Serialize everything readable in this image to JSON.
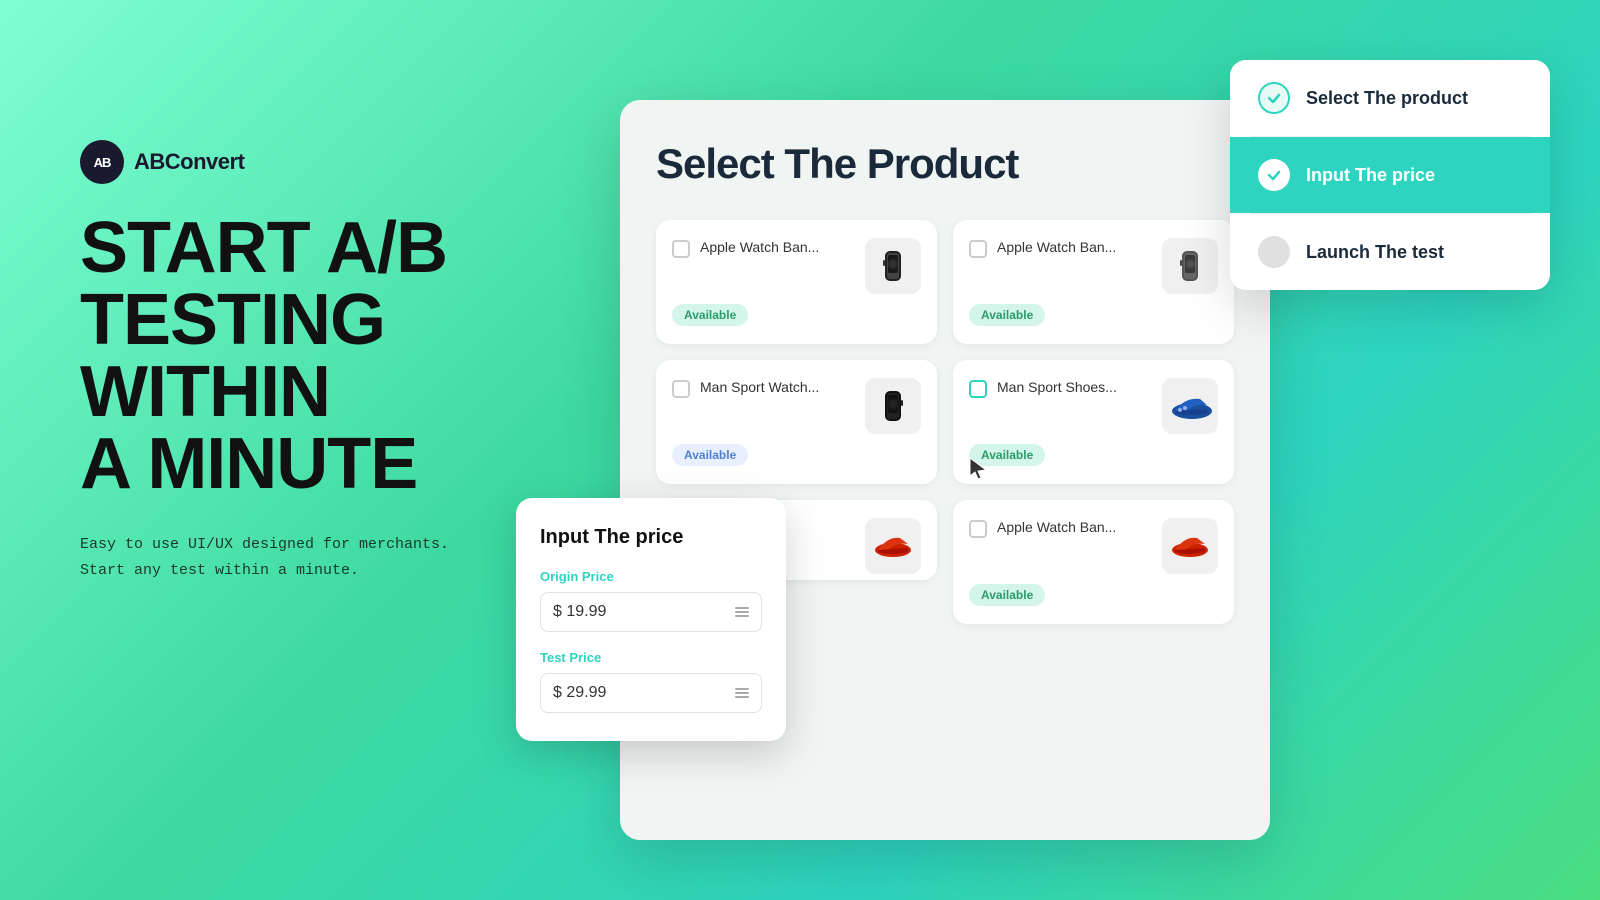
{
  "logo": {
    "icon_text": "AB",
    "name": "ABConvert"
  },
  "headline": {
    "line1": "START A/B",
    "line2": "TESTING",
    "line3": "WITHIN",
    "line4": "A MINUTE"
  },
  "subtext": {
    "line1": "Easy to use UI/UX designed for merchants.",
    "line2": "Start any test within a minute."
  },
  "main_card": {
    "title": "Select The  Product"
  },
  "products": [
    {
      "name": "Apple Watch Ban...",
      "status": "Available",
      "emoji": "⌚"
    },
    {
      "name": "Apple Watch Ban...",
      "status": "Available",
      "emoji": "⌚"
    },
    {
      "name": "Man Sport Watch...",
      "status": "",
      "emoji": "⌚"
    },
    {
      "name": "Man Sport Shoes...",
      "status": "Available",
      "emoji": "👟"
    },
    {
      "name": "...",
      "status": "",
      "emoji": "👟"
    },
    {
      "name": "Apple Watch Ban...",
      "status": "Available",
      "emoji": "👟"
    }
  ],
  "price_card": {
    "title": "Input The price",
    "origin_label": "Origin Price",
    "origin_value": "$ 19.99",
    "test_label": "Test Price",
    "test_value": "$ 29.99"
  },
  "steps": [
    {
      "label": "Select The product",
      "state": "completed"
    },
    {
      "label": "Input The price",
      "state": "active"
    },
    {
      "label": "Launch The test",
      "state": "pending"
    }
  ]
}
